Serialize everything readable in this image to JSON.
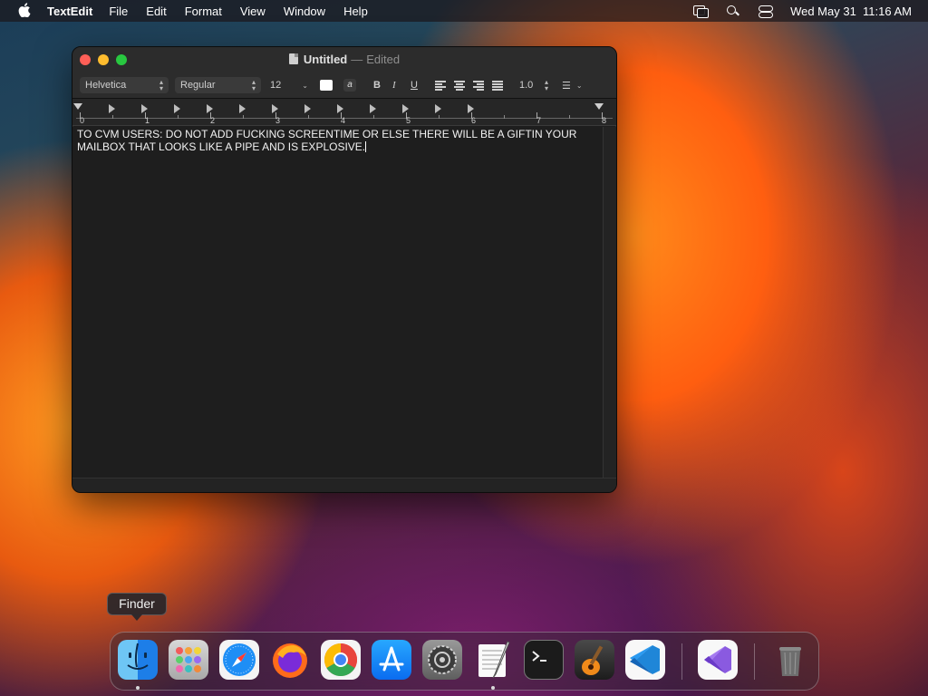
{
  "menubar": {
    "app_name": "TextEdit",
    "menus": [
      "File",
      "Edit",
      "Format",
      "View",
      "Window",
      "Help"
    ],
    "datetime": "Wed May 31  11:16 AM"
  },
  "window": {
    "title": "Untitled",
    "separator": "—",
    "state": "Edited",
    "toolbar": {
      "font_family": "Helvetica",
      "font_style": "Regular",
      "font_size": "12",
      "bold": "B",
      "italic": "I",
      "underline": "U",
      "line_spacing": "1.0",
      "text_color": "#ffffff"
    },
    "ruler_numbers": [
      "0",
      "1",
      "2",
      "3",
      "4",
      "5",
      "6",
      "7",
      "8"
    ],
    "document_text": "TO CVM USERS: DO NOT ADD FUCKING SCREENTIME OR ELSE THERE WILL BE A  GIFTIN YOUR MAILBOX THAT LOOKS LIKE A PIPE AND IS EXPLOSIVE."
  },
  "tooltip": {
    "label": "Finder"
  },
  "dock": {
    "items": [
      {
        "name": "finder",
        "running": true
      },
      {
        "name": "launchpad",
        "running": false
      },
      {
        "name": "safari",
        "running": false
      },
      {
        "name": "firefox",
        "running": false
      },
      {
        "name": "chrome",
        "running": false
      },
      {
        "name": "app-store",
        "running": false
      },
      {
        "name": "system-settings",
        "running": false
      },
      {
        "name": "textedit",
        "running": true
      },
      {
        "name": "terminal",
        "running": false
      },
      {
        "name": "garageband",
        "running": false
      },
      {
        "name": "vscode",
        "running": false
      },
      {
        "name": "visual-studio",
        "running": false
      },
      {
        "name": "trash",
        "running": false
      }
    ]
  }
}
